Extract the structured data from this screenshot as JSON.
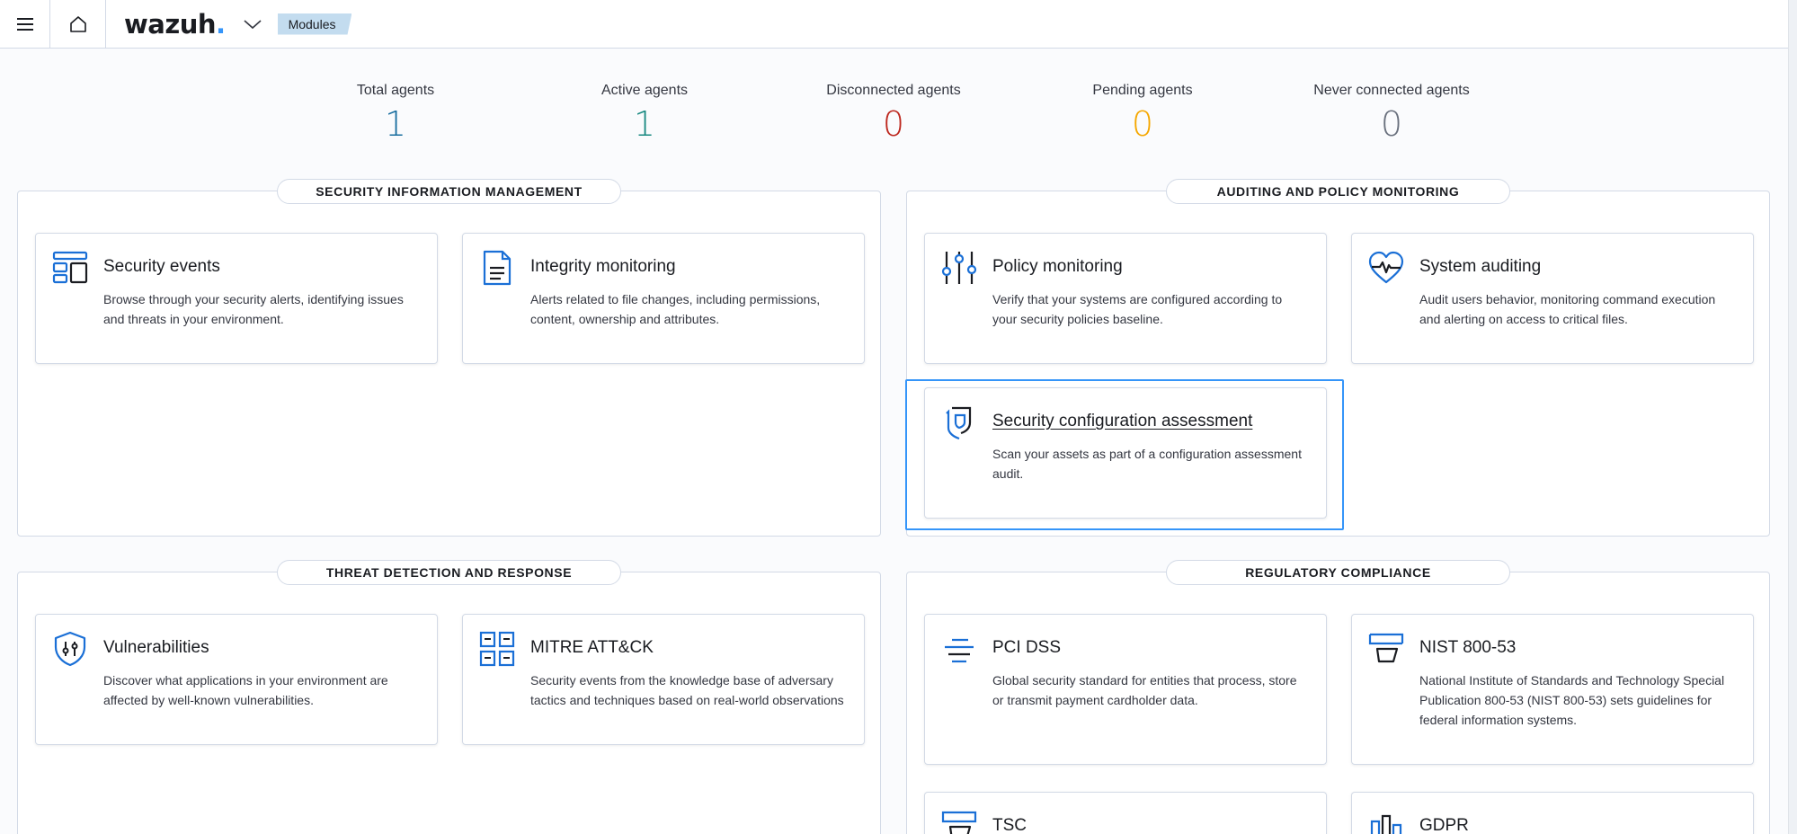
{
  "header": {
    "logo_text": "wazuh",
    "logo_dot": ".",
    "breadcrumb": "Modules"
  },
  "stats": [
    {
      "label": "Total agents",
      "value": "1",
      "color": "#1a6fa0"
    },
    {
      "label": "Active agents",
      "value": "1",
      "color": "#1a8a82"
    },
    {
      "label": "Disconnected agents",
      "value": "0",
      "color": "#bd271e"
    },
    {
      "label": "Pending agents",
      "value": "0",
      "color": "#f5a700"
    },
    {
      "label": "Never connected agents",
      "value": "0",
      "color": "#69707d"
    }
  ],
  "sections": {
    "security_information_management": {
      "title": "SECURITY INFORMATION MANAGEMENT",
      "cards": [
        {
          "icon": "dashboard-layout-icon",
          "title": "Security events",
          "description": "Browse through your security alerts, identifying issues and threats in your environment."
        },
        {
          "icon": "document-icon",
          "title": "Integrity monitoring",
          "description": "Alerts related to file changes, including permissions, content, ownership and attributes."
        }
      ]
    },
    "auditing_policy_monitoring": {
      "title": "AUDITING AND POLICY MONITORING",
      "cards": [
        {
          "icon": "sliders-icon",
          "title": "Policy monitoring",
          "description": "Verify that your systems are configured according to your security policies baseline."
        },
        {
          "icon": "heartbeat-icon",
          "title": "System auditing",
          "description": "Audit users behavior, monitoring command execution and alerting on access to critical files."
        },
        {
          "icon": "shield-check-icon",
          "title": "Security configuration assessment",
          "description": "Scan your assets as part of a configuration assessment audit."
        }
      ]
    },
    "threat_detection_response": {
      "title": "THREAT DETECTION AND RESPONSE",
      "cards": [
        {
          "icon": "shield-bug-icon",
          "title": "Vulnerabilities",
          "description": "Discover what applications in your environment are affected by well-known vulnerabilities."
        },
        {
          "icon": "grid-icon",
          "title": "MITRE ATT&CK",
          "description": "Security events from the knowledge base of adversary tactics and techniques based on real-world observations"
        }
      ]
    },
    "regulatory_compliance": {
      "title": "REGULATORY COMPLIANCE",
      "cards": [
        {
          "icon": "lines-icon",
          "title": "PCI DSS",
          "description": "Global security standard for entities that process, store or transmit payment cardholder data."
        },
        {
          "icon": "badge-icon",
          "title": "NIST 800-53",
          "description": "National Institute of Standards and Technology Special Publication 800-53 (NIST 800-53) sets guidelines for federal information systems."
        },
        {
          "icon": "badge-icon",
          "title": "TSC",
          "description": ""
        },
        {
          "icon": "building-icon",
          "title": "GDPR",
          "description": ""
        }
      ]
    }
  },
  "colors": {
    "accent": "#3595f9",
    "icon": "#1a6fd6"
  }
}
